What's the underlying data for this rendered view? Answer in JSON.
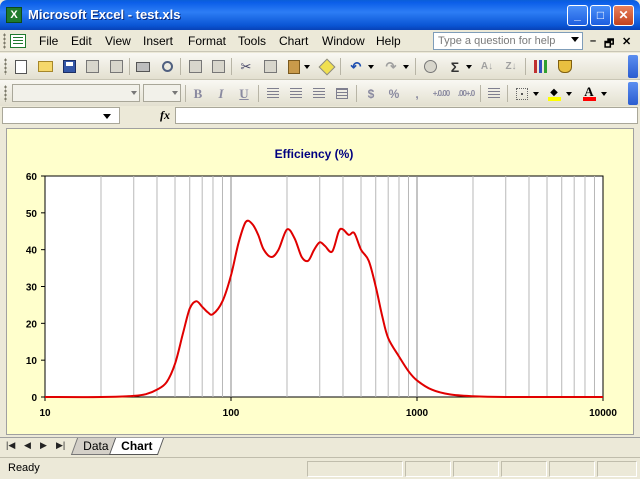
{
  "window": {
    "title": "Microsoft Excel - test.xls",
    "app_icon_letter": "X",
    "minimize": "_",
    "maximize": "□",
    "close": "✕"
  },
  "menu": {
    "items": [
      "File",
      "Edit",
      "View",
      "Insert",
      "Format",
      "Tools",
      "Chart",
      "Window",
      "Help"
    ],
    "ask_placeholder": "Type a question for help",
    "doc_minimize": "–",
    "doc_restore": "🗗",
    "doc_close": "✕"
  },
  "toolbar": {
    "font_name": "",
    "font_size": "",
    "bold": "B",
    "italic": "I",
    "underline": "U",
    "currency": "$",
    "percent": "%",
    "comma": ",",
    "increase_decimal": "+.0.00",
    "decrease_decimal": ".00+.0",
    "sigma": "Σ",
    "font_color_letter": "A"
  },
  "formula_bar": {
    "name_box": "",
    "fx": "fx",
    "formula": ""
  },
  "sheets": {
    "nav": [
      "|◀",
      "◀",
      "▶",
      "▶|"
    ],
    "tabs": [
      "Data",
      "Chart"
    ],
    "active": "Chart"
  },
  "status": {
    "text": "Ready"
  },
  "colors": {
    "chart_background": "#ffffcc",
    "plot_background": "#ffffff",
    "series_line": "#e00000",
    "title_text": "#000080",
    "titlebar": "#0b5ee8"
  },
  "chart_data": {
    "type": "line",
    "title": "Efficiency  (%)",
    "xlabel": "",
    "ylabel": "",
    "xscale": "log",
    "xlim": [
      10,
      10000
    ],
    "ylim": [
      0,
      60
    ],
    "xticks": [
      10,
      100,
      1000,
      10000
    ],
    "xtick_labels": [
      "10",
      "100",
      "1000",
      "10000"
    ],
    "yticks": [
      0,
      10,
      20,
      30,
      40,
      50,
      60
    ],
    "ytick_labels": [
      "0",
      "10",
      "20",
      "30",
      "40",
      "50",
      "60"
    ],
    "grid": true,
    "legend": "none",
    "series": [
      {
        "x": [
          10,
          20,
          30,
          35,
          40,
          45,
          50,
          55,
          60,
          65,
          70,
          75,
          80,
          90,
          100,
          110,
          120,
          130,
          140,
          150,
          165,
          180,
          200,
          220,
          240,
          260,
          280,
          300,
          320,
          350,
          380,
          400,
          430,
          460,
          500,
          550,
          600,
          650,
          700,
          800,
          900,
          1000,
          1200,
          1500,
          2000,
          3000,
          5000,
          10000
        ],
        "y": [
          0,
          0,
          0.3,
          0.8,
          2,
          4,
          9,
          17,
          24,
          26,
          24.5,
          23,
          22.5,
          26,
          33,
          42,
          47.5,
          47,
          44,
          40,
          38,
          40,
          45.5,
          43,
          38,
          37,
          40,
          42,
          41,
          39.5,
          45,
          45.5,
          44,
          44.5,
          40,
          37,
          30,
          22,
          16,
          11,
          7,
          4.5,
          2,
          0.7,
          0.2,
          0,
          0,
          0
        ]
      }
    ]
  }
}
